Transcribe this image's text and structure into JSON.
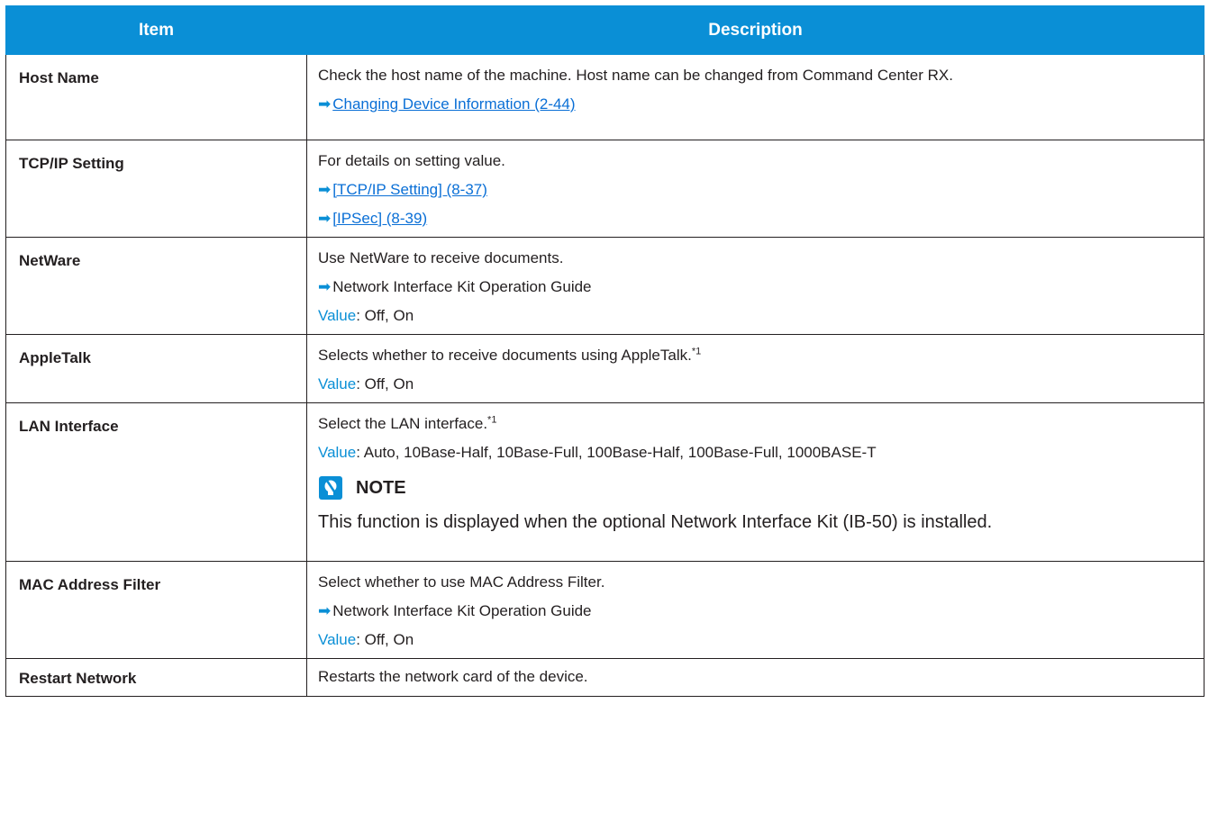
{
  "headers": {
    "item": "Item",
    "description": "Description"
  },
  "rows": [
    {
      "item": "Host Name",
      "desc": "Check the host name of the machine. Host name can be changed from Command Center RX.",
      "link": "Changing Device Information (2-44)"
    },
    {
      "item": "TCP/IP Setting",
      "desc": "For details on setting value.",
      "link1": "[TCP/IP Setting] (8-37)",
      "link2": "[IPSec] (8-39)"
    },
    {
      "item": "NetWare",
      "desc": "Use NetWare to receive documents.",
      "ref": "Network Interface Kit Operation Guide",
      "value_label": "Value",
      "value": ": Off, On"
    },
    {
      "item": "AppleTalk",
      "desc": "Selects whether to receive documents using AppleTalk.",
      "footnote": "*1",
      "value_label": "Value",
      "value": ": Off, On"
    },
    {
      "item": "LAN Interface",
      "desc": "Select the LAN interface.",
      "footnote": "*1",
      "value_label": "Value",
      "value": ": Auto, 10Base-Half, 10Base-Full, 100Base-Half, 100Base-Full, 1000BASE-T",
      "note_title": "NOTE",
      "note_text": "This function is displayed when the optional Network Interface Kit (IB-50) is installed."
    },
    {
      "item": "MAC Address Filter",
      "desc": "Select whether to use MAC Address Filter.",
      "ref": "Network Interface Kit Operation Guide",
      "value_label": "Value",
      "value": ": Off, On"
    },
    {
      "item": "Restart Network",
      "desc": "Restarts the network card of the device."
    }
  ],
  "icons": {
    "arrow": "right-arrow-icon",
    "note": "note-lightbulb-icon"
  },
  "colors": {
    "header_bg": "#0a8fd6",
    "accent": "#0a8fd6",
    "link": "#0a6fd6"
  }
}
